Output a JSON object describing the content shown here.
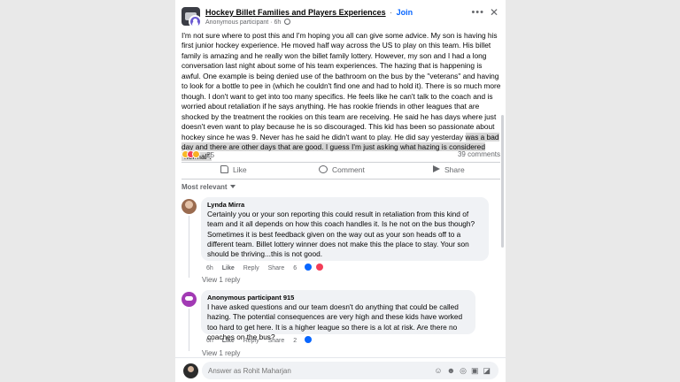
{
  "post": {
    "group_name": "Hockey Billet Families and Players Experiences",
    "separator": "·",
    "join_label": "Join",
    "author": "Anonymous participant",
    "time": "6h",
    "body_text": "I'm not sure where to post this and I'm hoping you all can give some advice. My son is having his first junior hockey experience. He moved half way across the US to play on this team. His billet family is amazing and he really won the billet family lottery. However, my son and I had a long conversation last night about some of his team experiences. The hazing that is happening is awful. One example is being denied use of the bathroom on the bus by the \"veterans\" and having to look for a bottle to pee in (which he couldn't find one and had to hold it). There is so much more though. I don't want to get into too many specifics. He feels like he can't talk to the coach and is worried about retaliation if he says anything. He has rookie friends in other leagues that are shocked by the treatment the rookies on this team are receiving. He said he has days where just doesn't even want to play because he is so discouraged. This kid has been so passionate about hockey since he was 9. Never has he said he didn't want to play. He did say yesterday ",
    "body_highlight": "was a bad day and there are other days that are good. I guess I'm just asking what hazing is considered \"normal\".",
    "reaction_count": "25",
    "comments_count": "39 comments"
  },
  "actions": {
    "like": "Like",
    "comment": "Comment",
    "share": "Share"
  },
  "sort_label": "Most relevant",
  "comments": [
    {
      "author": "Lynda Mirra",
      "text": "Certainly you or your son reporting this could result in retaliation from this kind of team and it all depends on how this coach handles it. Is he not on the bus though? Sometimes it is best feedback given on the way out as your son heads off to a different team. Billet lottery winner does not make this the place to stay. Your son should be thriving...this is not good.",
      "time": "6h",
      "like": "Like",
      "reply": "Reply",
      "share": "Share",
      "reactions": "6",
      "view_replies": "View 1 reply"
    },
    {
      "author": "Anonymous participant 915",
      "text": "I have asked questions and our team doesn't do anything that could be called hazing. The potential consequences are very high and these kids have worked too hard to get here. It is a higher league so there is a lot at risk. Are there no coaches on the bus?",
      "time": "6h",
      "like": "Like",
      "reply": "Reply",
      "share": "Share",
      "reactions": "2",
      "view_replies": "View 1 reply"
    }
  ],
  "composer": {
    "placeholder": "Answer as Rohit Maharjan"
  },
  "icons": [
    "globe-icon",
    "more-icon",
    "close-icon",
    "like-icon",
    "comment-icon",
    "share-icon",
    "chevron-down-icon",
    "sticker-icon",
    "emoji-icon",
    "camera-icon",
    "gif-icon"
  ],
  "colors": {
    "accent": "#0866ff",
    "page_background": "#e9e9e9",
    "bubble_background": "#f0f2f5",
    "secondary_text": "#65676b",
    "highlight": "#d6d6d6"
  }
}
